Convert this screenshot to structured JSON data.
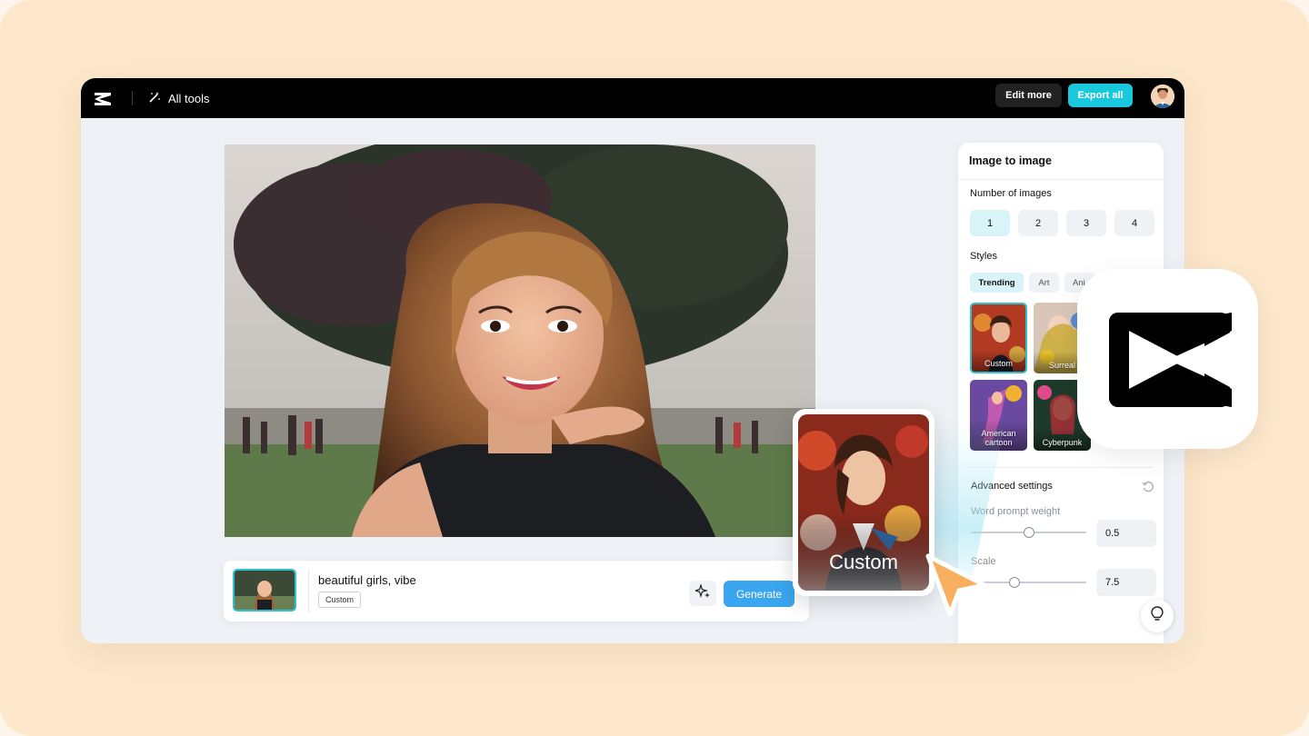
{
  "topbar": {
    "all_tools_label": "All tools",
    "edit_more_label": "Edit more",
    "export_all_label": "Export all"
  },
  "prompt": {
    "text": "beautiful girls, vibe",
    "style_tag": "Custom",
    "generate_label": "Generate"
  },
  "panel": {
    "title": "Image to image",
    "number_label": "Number of images",
    "numbers": [
      "1",
      "2",
      "3",
      "4"
    ],
    "styles_label": "Styles",
    "style_tabs": [
      "Trending",
      "Art",
      "Ani"
    ],
    "style_cards": [
      "Custom",
      "Surreal",
      "American cartoon",
      "Cyberpunk"
    ],
    "advanced_label": "Advanced settings",
    "word_prompt_label": "Word prompt weight",
    "word_prompt_value": "0.5",
    "scale_label": "Scale",
    "scale_value": "7.5"
  },
  "floating_card": {
    "label": "Custom"
  },
  "colors": {
    "accent": "#19c8dd",
    "generate": "#3aa6f0",
    "background": "#fde8cc",
    "topbar": "#000000"
  }
}
